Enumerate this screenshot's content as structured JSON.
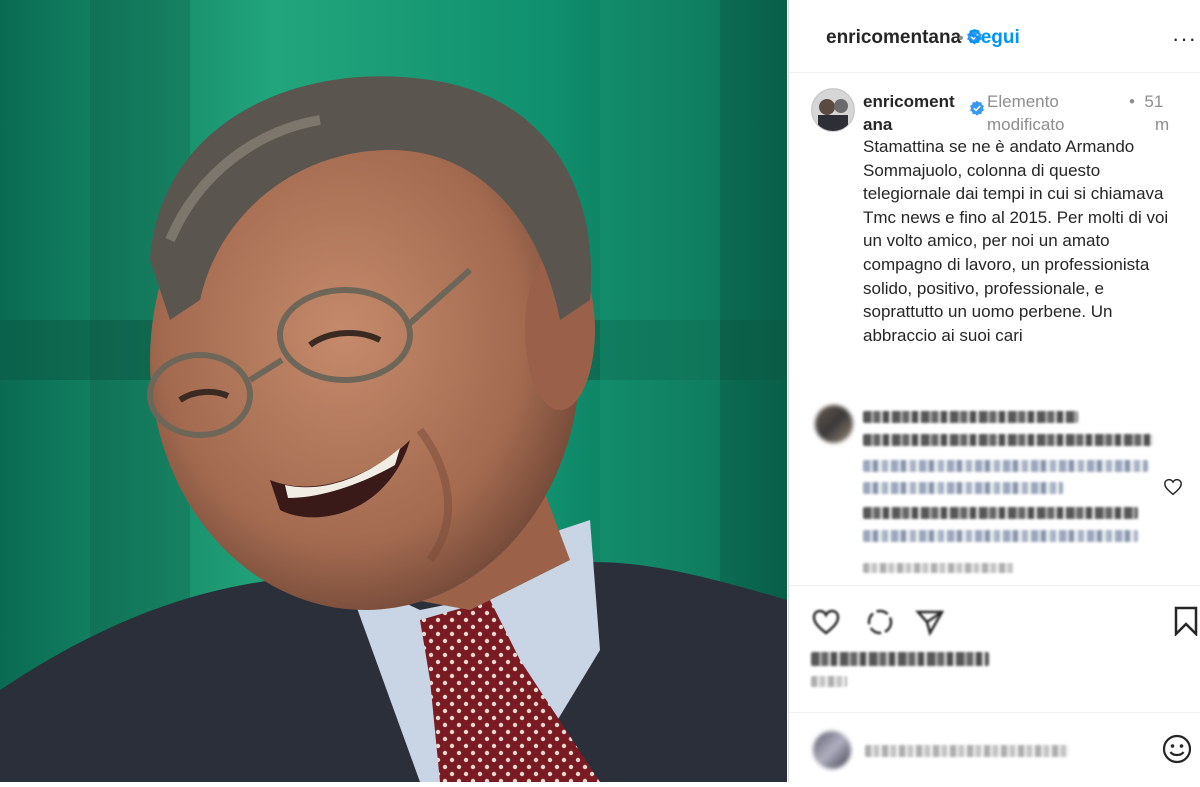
{
  "post": {
    "username": "enricomentana",
    "follow_label": "Segui",
    "separator": "•",
    "more_label": "···",
    "photo_description_icon": "portrait-photo"
  },
  "caption": {
    "username_line1": "enricoment",
    "username_line2": "ana",
    "edited_line1": "Elemento",
    "edited_line2": "modificato",
    "time_dot": "•",
    "time_line1": "51",
    "time_line2": "m",
    "text": "Stamattina se ne è andato Armando Sommajuolo, colonna di questo telegiornale dai tempi in cui si chiamava Tmc news e fino al 2015. Per molti di voi un volto amico, per noi un amato compagno di lavoro, un professionista solido, positivo, professionale, e soprattutto un uomo perbene. Un abbraccio ai suoi cari"
  },
  "icons": {
    "verified": "verified-badge-icon",
    "like": "heart-icon",
    "comment": "comment-icon",
    "share": "share-icon",
    "save": "bookmark-icon",
    "emoji": "emoji-icon"
  },
  "colors": {
    "link_blue": "#0095f6",
    "meta_grey": "#8e8e8e",
    "text": "#262626",
    "border": "#dbdbdb"
  }
}
